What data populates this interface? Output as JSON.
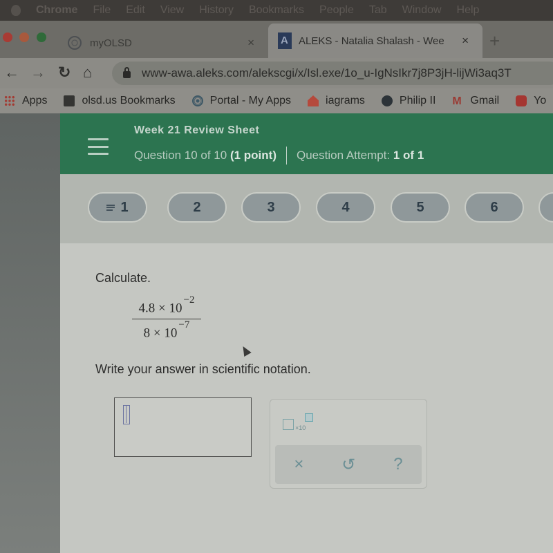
{
  "os_menubar": {
    "items": [
      "Chrome",
      "File",
      "Edit",
      "View",
      "History",
      "Bookmarks",
      "People",
      "Tab",
      "Window",
      "Help"
    ]
  },
  "browser": {
    "tabs": [
      {
        "title": "myOLSD",
        "icon": "portal-icon",
        "active": false
      },
      {
        "title": "ALEKS - Natalia Shalash - Wee",
        "icon": "aleks-icon",
        "active": true
      }
    ],
    "new_tab_label": "+",
    "close_glyph": "×",
    "url": "www-awa.aleks.com/alekscgi/x/Isl.exe/1o_u-IgNsIkr7j8P3jH-lijWi3aq3T",
    "nav_glyphs": {
      "back": "←",
      "forward": "→",
      "reload": "↻",
      "home": "⌂"
    },
    "bookmarks": [
      {
        "label": "Apps",
        "icon": "apps-grid-icon"
      },
      {
        "label": "olsd.us Bookmarks",
        "icon": "folder-icon"
      },
      {
        "label": "Portal - My Apps",
        "icon": "portal-icon"
      },
      {
        "label": "iagrams",
        "icon": "home-icon"
      },
      {
        "label": "Philip II",
        "icon": "globe-icon"
      },
      {
        "label": "Gmail",
        "icon": "gmail-icon",
        "glyph": "M"
      },
      {
        "label": "Yo",
        "icon": "youtube-icon"
      }
    ]
  },
  "aleks": {
    "header": {
      "title": "Week 21 Review Sheet",
      "question_text": "Question 10 of 10",
      "points": "(1 point)",
      "attempt_label": "Question Attempt:",
      "attempt_value": "1 of 1",
      "header_color": "#2c7450"
    },
    "question_nav": [
      {
        "label": "1",
        "has_list_icon": true
      },
      {
        "label": "2"
      },
      {
        "label": "3"
      },
      {
        "label": "4"
      },
      {
        "label": "5"
      },
      {
        "label": "6"
      }
    ],
    "problem": {
      "instruction": "Calculate.",
      "numerator": {
        "mantissa": "4.8 × 10",
        "exponent": "−2"
      },
      "denominator": {
        "mantissa": "8 × 10",
        "exponent": "−7"
      },
      "prompt": "Write your answer in scientific notation."
    },
    "answer": {
      "value": ""
    },
    "tools": {
      "sci_notation_label": "×10",
      "clear_glyph": "×",
      "undo_glyph": "↺",
      "help_glyph": "?"
    }
  }
}
